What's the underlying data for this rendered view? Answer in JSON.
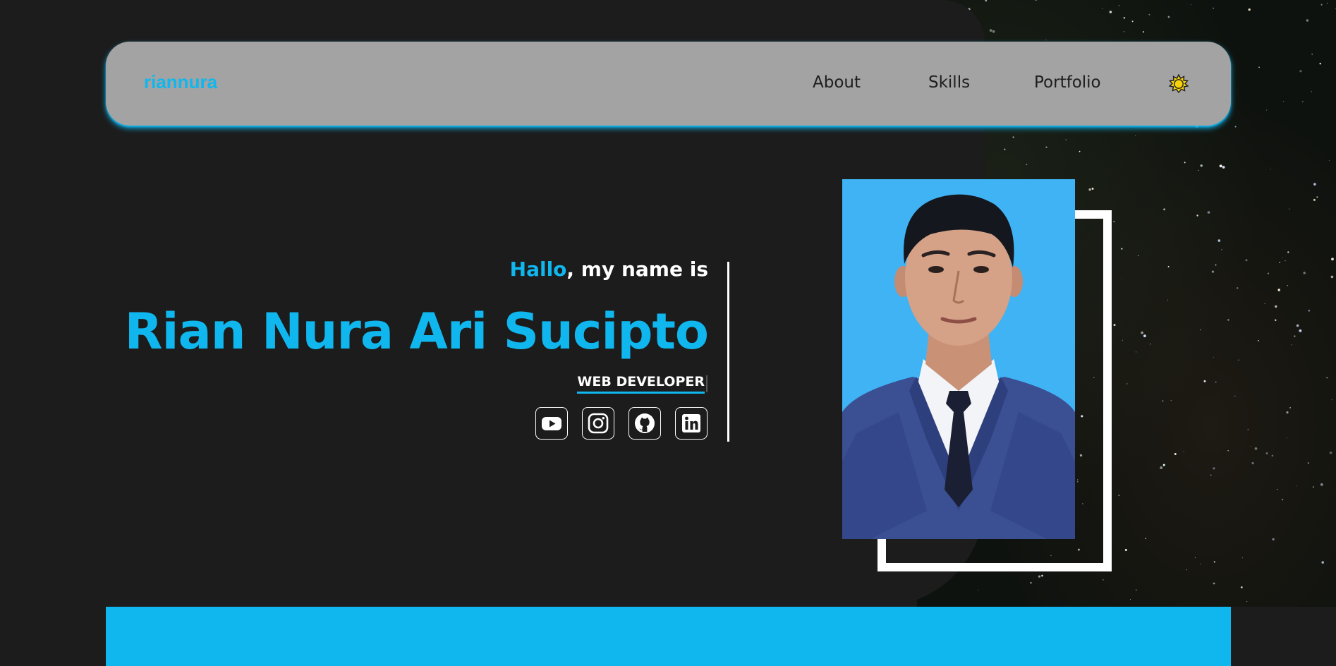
{
  "navbar": {
    "brand": "riannura",
    "links": [
      "About",
      "Skills",
      "Portfolio"
    ],
    "theme_toggle_icon": "sun-icon"
  },
  "hero": {
    "greeting_highlight": "Hallo",
    "greeting_rest": ", my name is",
    "name": "Rian Nura Ari Sucipto",
    "role": "WEB DEVELOPER",
    "social_icons": [
      "youtube-icon",
      "instagram-icon",
      "github-icon",
      "linkedin-icon"
    ]
  },
  "colors": {
    "accent": "#10b7ee",
    "background": "#1c1c1c",
    "navbar": "#a3a3a3",
    "photo_background": "#3fb3f4"
  }
}
